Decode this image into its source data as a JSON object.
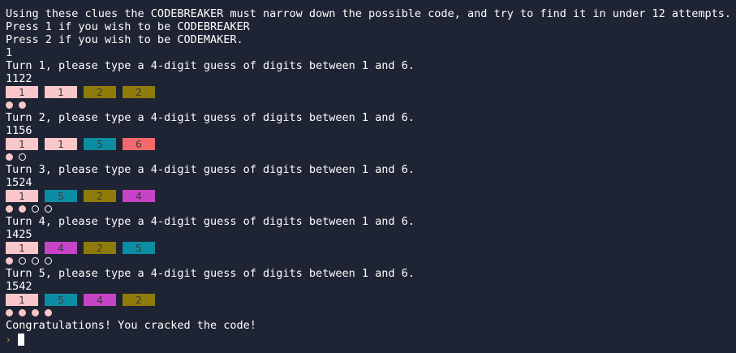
{
  "intro": {
    "line1": "Using these clues the CODEBREAKER must narrow down the possible code, and try to find it in under 12 attempts.",
    "line2": "Press 1 if you wish to be CODEBREAKER",
    "line3": "Press 2 if you wish to be CODEMAKER.",
    "choice": "1"
  },
  "colors": {
    "background": "#1e2433",
    "peg_1": "#f9c6c9",
    "peg_2": "#8e7b0a",
    "peg_4": "#c743c7",
    "peg_5": "#0d8da3",
    "peg_6": "#f4696b",
    "prompt_symbol": "#d8a52c"
  },
  "turns": [
    {
      "prompt": "Turn 1, please type a 4-digit guess of digits between 1 and 6.",
      "guess": "1122",
      "pegs": [
        "1",
        "1",
        "2",
        "2"
      ],
      "feedback": [
        "exact",
        "exact"
      ]
    },
    {
      "prompt": "Turn 2, please type a 4-digit guess of digits between 1 and 6.",
      "guess": "1156",
      "pegs": [
        "1",
        "1",
        "5",
        "6"
      ],
      "feedback": [
        "exact",
        "near"
      ]
    },
    {
      "prompt": "Turn 3, please type a 4-digit guess of digits between 1 and 6.",
      "guess": "1524",
      "pegs": [
        "1",
        "5",
        "2",
        "4"
      ],
      "feedback": [
        "exact",
        "exact",
        "near",
        "near"
      ]
    },
    {
      "prompt": "Turn 4, please type a 4-digit guess of digits between 1 and 6.",
      "guess": "1425",
      "pegs": [
        "1",
        "4",
        "2",
        "5"
      ],
      "feedback": [
        "exact",
        "near",
        "near",
        "near"
      ]
    },
    {
      "prompt": "Turn 5, please type a 4-digit guess of digits between 1 and 6.",
      "guess": "1542",
      "pegs": [
        "1",
        "5",
        "4",
        "2"
      ],
      "feedback": [
        "exact",
        "exact",
        "exact",
        "exact"
      ]
    }
  ],
  "result": "Congratulations! You cracked the code!",
  "prompt": {
    "symbol_icon": "chevron-right-icon",
    "symbol": "›"
  }
}
